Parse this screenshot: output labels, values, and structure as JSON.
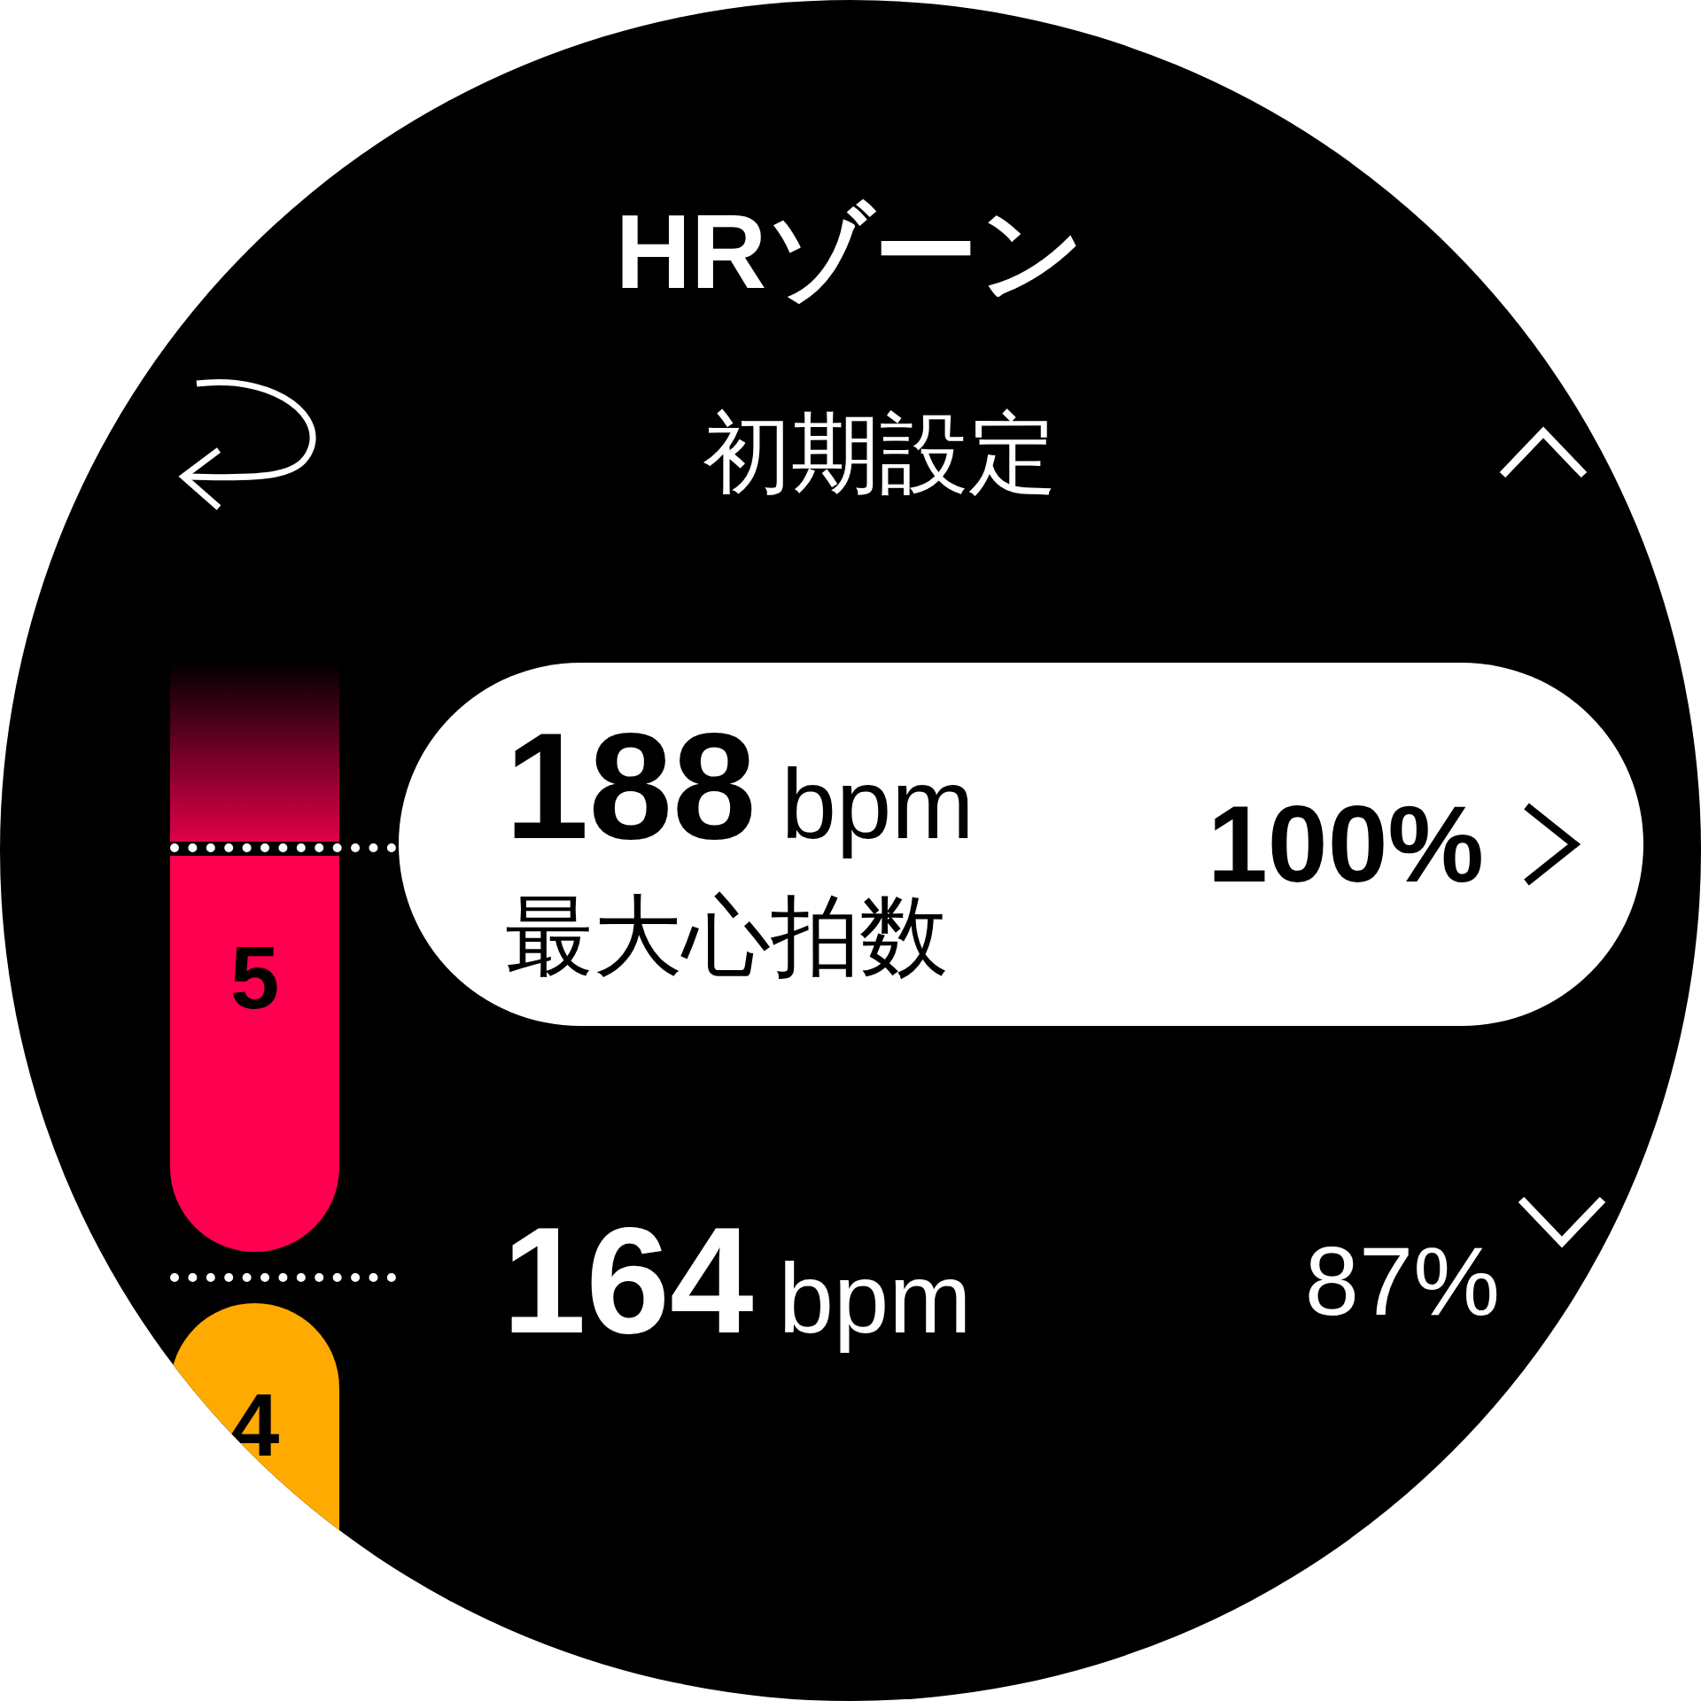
{
  "title": "HRゾーン",
  "subtitle": "初期設定",
  "zones": [
    {
      "number": "5",
      "color": "#ff0050"
    },
    {
      "number": "4",
      "color": "#ffaa00"
    }
  ],
  "rows": [
    {
      "value": "188",
      "unit": "bpm",
      "percent": "100%",
      "label": "最大心拍数",
      "selected": true
    },
    {
      "value": "164",
      "unit": "bpm",
      "percent": "87%",
      "selected": false
    }
  ]
}
